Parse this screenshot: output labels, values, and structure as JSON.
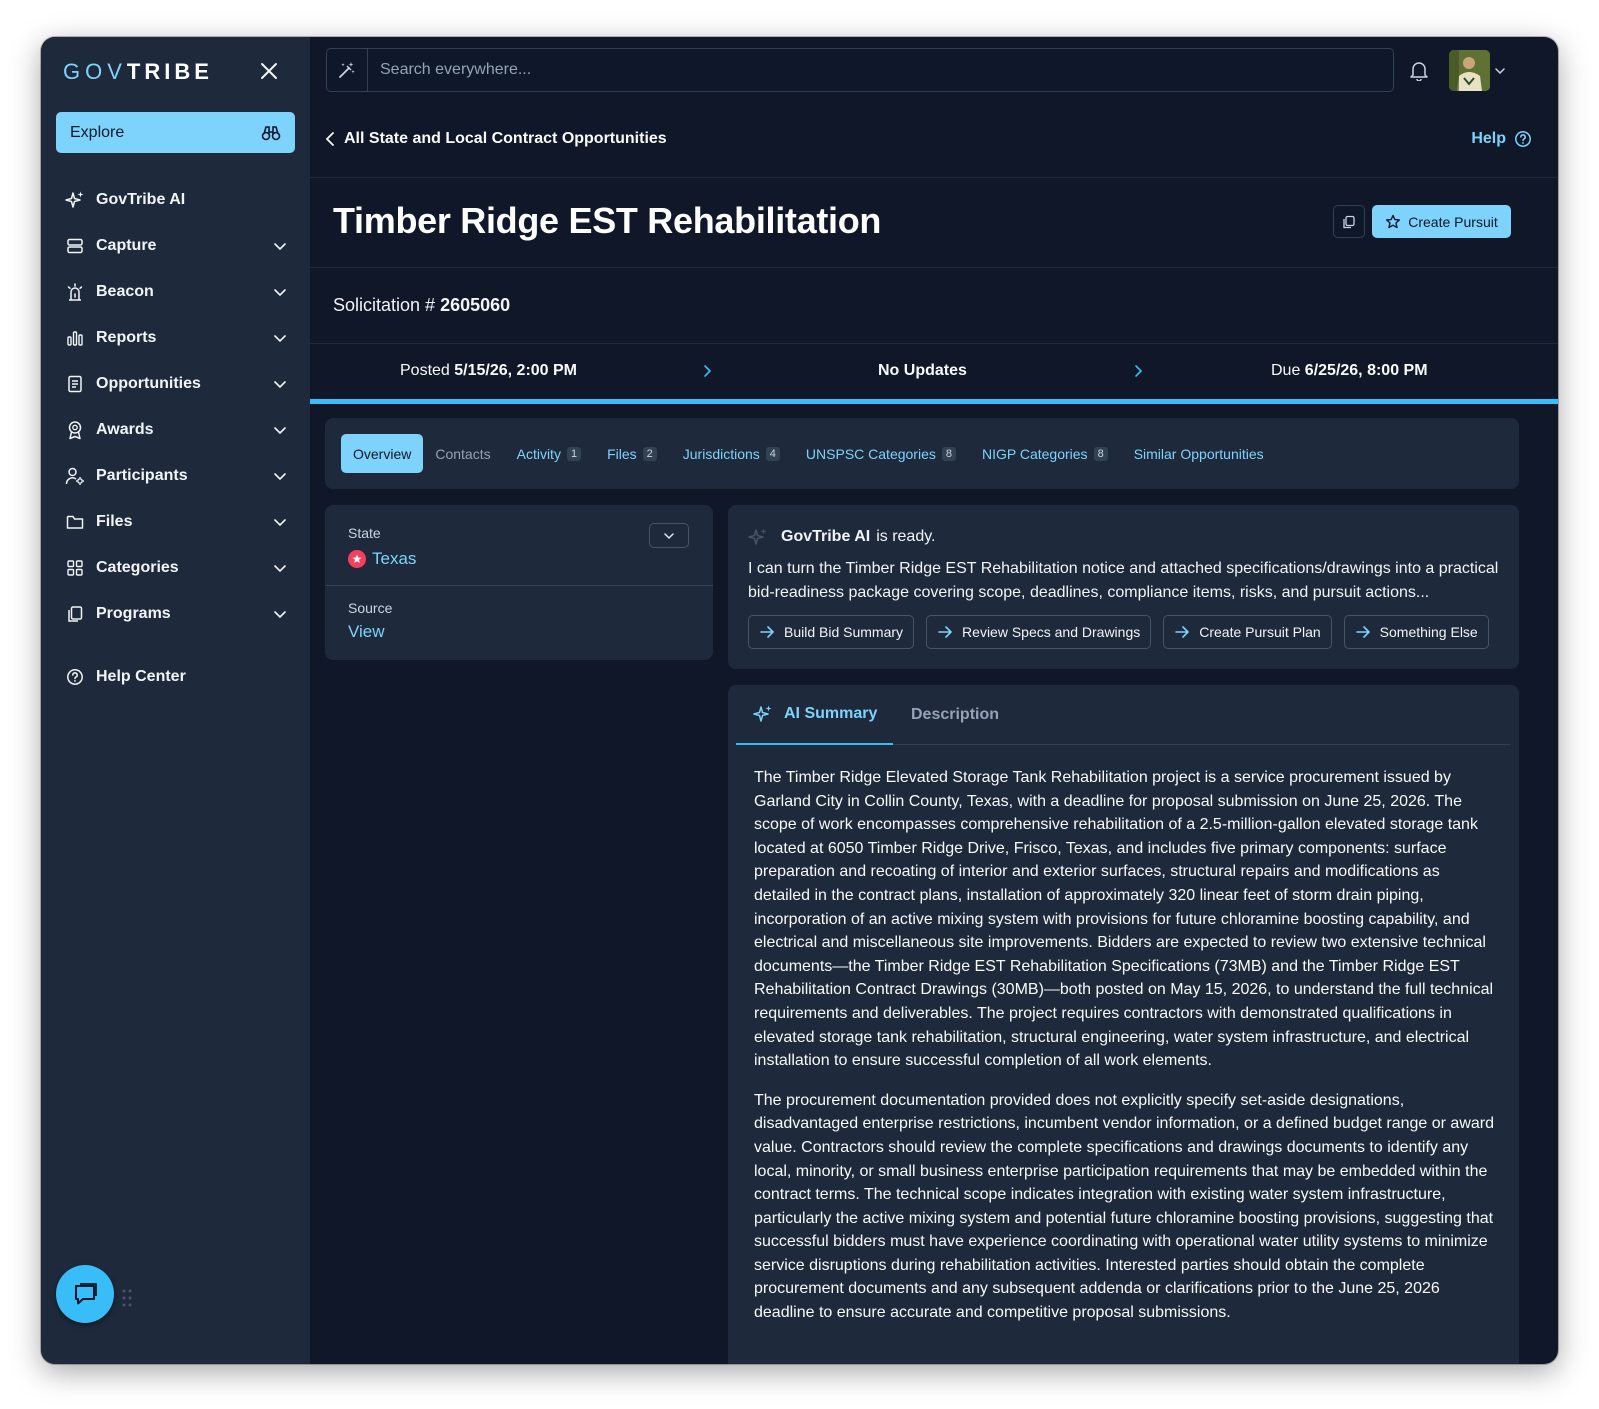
{
  "sidebar": {
    "logo_light": "GOV",
    "logo_bold": "TRIBE",
    "explore_label": "Explore",
    "items": [
      {
        "label": "GovTribe AI"
      },
      {
        "label": "Capture"
      },
      {
        "label": "Beacon"
      },
      {
        "label": "Reports"
      },
      {
        "label": "Opportunities"
      },
      {
        "label": "Awards"
      },
      {
        "label": "Participants"
      },
      {
        "label": "Files"
      },
      {
        "label": "Categories"
      },
      {
        "label": "Programs"
      }
    ],
    "help_center_label": "Help Center"
  },
  "topbar": {
    "search_placeholder": "Search everywhere..."
  },
  "header": {
    "back_label": "All State and Local Contract Opportunities",
    "help_label": "Help",
    "title": "Timber Ridge EST Rehabilitation",
    "create_pursuit_label": "Create Pursuit",
    "solicitation_prefix": "Solicitation # ",
    "solicitation_number": "2605060"
  },
  "timeline": {
    "posted_prefix": "Posted ",
    "posted_value": "5/15/26, 2:00 PM",
    "updates_label": "No Updates",
    "due_prefix": "Due ",
    "due_value": "6/25/26, 8:00 PM",
    "progress": 1.0
  },
  "tabs": [
    {
      "label": "Overview",
      "count": ""
    },
    {
      "label": "Contacts",
      "count": ""
    },
    {
      "label": "Activity",
      "count": "1"
    },
    {
      "label": "Files",
      "count": "2"
    },
    {
      "label": "Jurisdictions",
      "count": "4"
    },
    {
      "label": "UNSPSC Categories",
      "count": "8"
    },
    {
      "label": "NIGP Categories",
      "count": "8"
    },
    {
      "label": "Similar Opportunities",
      "count": ""
    }
  ],
  "info": {
    "state_label": "State",
    "state_value": "Texas",
    "source_label": "Source",
    "source_value": "View"
  },
  "ai_ready": {
    "name": "GovTribe AI",
    "status": "is ready.",
    "text": "I can turn the Timber Ridge EST Rehabilitation notice and attached specifications/drawings into a practical bid-readiness package covering scope, deadlines, compliance items, risks, and pursuit actions...",
    "actions": [
      "Build Bid Summary",
      "Review Specs and Drawings",
      "Create Pursuit Plan",
      "Something Else"
    ]
  },
  "summary": {
    "tab_ai": "AI Summary",
    "tab_desc": "Description",
    "paragraphs": [
      "The Timber Ridge Elevated Storage Tank Rehabilitation project is a service procurement issued by Garland City in Collin County, Texas, with a deadline for proposal submission on June 25, 2026. The scope of work encompasses comprehensive rehabilitation of a 2.5-million-gallon elevated storage tank located at 6050 Timber Ridge Drive, Frisco, Texas, and includes five primary components: surface preparation and recoating of interior and exterior surfaces, structural repairs and modifications as detailed in the contract plans, installation of approximately 320 linear feet of storm drain piping, incorporation of an active mixing system with provisions for future chloramine boosting capability, and electrical and miscellaneous site improvements. Bidders are expected to review two extensive technical documents—the Timber Ridge EST Rehabilitation Specifications (73MB) and the Timber Ridge EST Rehabilitation Contract Drawings (30MB)—both posted on May 15, 2026, to understand the full technical requirements and deliverables. The project requires contractors with demonstrated qualifications in elevated storage tank rehabilitation, structural engineering, water system infrastructure, and electrical installation to ensure successful completion of all work elements.",
      "The procurement documentation provided does not explicitly specify set-aside designations, disadvantaged enterprise restrictions, incumbent vendor information, or a defined budget range or award value. Contractors should review the complete specifications and drawings documents to identify any local, minority, or small business enterprise participation requirements that may be embedded within the contract terms. The technical scope indicates integration with existing water system infrastructure, particularly the active mixing system and potential future chloramine boosting provisions, suggesting that successful bidders must have experience coordinating with operational water utility systems to minimize service disruptions during rehabilitation activities. Interested parties should obtain the complete procurement documents and any subsequent addenda or clarifications prior to the June 25, 2026 deadline to ensure accurate and competitive proposal submissions."
    ]
  },
  "colors": {
    "accent": "#7dd3fc",
    "accent_strong": "#38bdf8",
    "sidebar_bg": "#1e293b",
    "page_bg": "#0f1728",
    "card_bg": "#1e293b",
    "texas_badge": "#f43f5e"
  }
}
